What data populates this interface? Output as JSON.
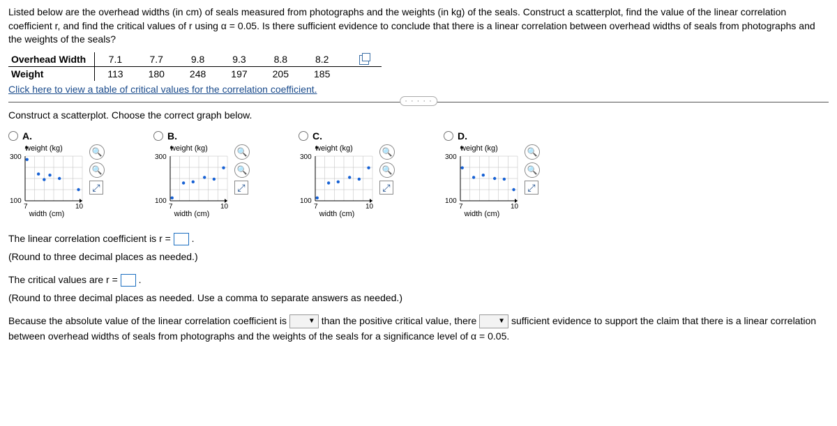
{
  "intro": "Listed below are the overhead widths (in cm) of seals measured from photographs and the weights (in kg) of the seals. Construct a scatterplot, find the value of the linear correlation coefficient r, and find the critical values of r using α = 0.05. Is there sufficient evidence to conclude that there is a linear correlation between overhead widths of seals from photographs and the weights of the seals?",
  "table": {
    "row1_label": "Overhead Width",
    "row2_label": "Weight",
    "widths": [
      "7.1",
      "7.7",
      "9.8",
      "9.3",
      "8.8",
      "8.2"
    ],
    "weights": [
      "113",
      "180",
      "248",
      "197",
      "205",
      "185"
    ]
  },
  "link_text": "Click here to view a table of critical values for the correlation coefficient.",
  "prompt_scatter": "Construct a scatterplot. Choose the correct graph below.",
  "options": {
    "A": {
      "label": "A.",
      "ylab": "weight (kg)",
      "xlab": "width (cm)",
      "ymin": "100",
      "ymax": "300",
      "xmin": "7",
      "xmax": "10"
    },
    "B": {
      "label": "B.",
      "ylab": "weight (kg)",
      "xlab": "width (cm)",
      "ymin": "100",
      "ymax": "300",
      "xmin": "7",
      "xmax": "10"
    },
    "C": {
      "label": "C.",
      "ylab": "weight (kg)",
      "xlab": "width (cm)",
      "ymin": "100",
      "ymax": "300",
      "xmin": "7",
      "xmax": "10"
    },
    "D": {
      "label": "D.",
      "ylab": "weight (kg)",
      "xlab": "width (cm)",
      "ymin": "100",
      "ymax": "300",
      "xmin": "7",
      "xmax": "10"
    }
  },
  "q1_pre": "The linear correlation coefficient is r = ",
  "q1_post": ".",
  "q1_hint": "(Round to three decimal places as needed.)",
  "q2_pre": "The critical values are r = ",
  "q2_post": ".",
  "q2_hint": "(Round to three decimal places as needed. Use a comma to separate answers as needed.)",
  "concl_1": "Because the absolute value of the linear correlation coefficient is ",
  "concl_2": " than the positive critical value, there ",
  "concl_3": " sufficient evidence to support the claim that there is a linear correlation between overhead widths of seals from photographs and the weights of the seals for a significance level of α = 0.05.",
  "chart_data": [
    {
      "option": "A",
      "type": "scatter",
      "xlabel": "width (cm)",
      "ylabel": "weight (kg)",
      "xlim": [
        7,
        10
      ],
      "ylim": [
        100,
        300
      ],
      "points": [
        [
          7.1,
          285
        ],
        [
          7.7,
          220
        ],
        [
          8.0,
          195
        ],
        [
          8.3,
          215
        ],
        [
          8.8,
          200
        ],
        [
          9.8,
          150
        ]
      ]
    },
    {
      "option": "B",
      "type": "scatter",
      "xlabel": "width (cm)",
      "ylabel": "weight (kg)",
      "xlim": [
        7,
        10
      ],
      "ylim": [
        100,
        300
      ],
      "points": [
        [
          7.1,
          113
        ],
        [
          7.7,
          180
        ],
        [
          8.2,
          185
        ],
        [
          8.8,
          205
        ],
        [
          9.3,
          197
        ],
        [
          9.8,
          248
        ]
      ]
    },
    {
      "option": "C",
      "type": "scatter",
      "xlabel": "width (cm)",
      "ylabel": "weight (kg)",
      "xlim": [
        7,
        10
      ],
      "ylim": [
        100,
        300
      ],
      "points": [
        [
          7.1,
          113
        ],
        [
          7.7,
          180
        ],
        [
          8.2,
          185
        ],
        [
          8.8,
          205
        ],
        [
          9.3,
          197
        ],
        [
          9.8,
          248
        ]
      ]
    },
    {
      "option": "D",
      "type": "scatter",
      "xlabel": "width (cm)",
      "ylabel": "weight (kg)",
      "xlim": [
        7,
        10
      ],
      "ylim": [
        100,
        300
      ],
      "points": [
        [
          7.1,
          248
        ],
        [
          7.7,
          205
        ],
        [
          8.2,
          215
        ],
        [
          8.8,
          200
        ],
        [
          9.3,
          197
        ],
        [
          9.8,
          150
        ]
      ]
    }
  ]
}
